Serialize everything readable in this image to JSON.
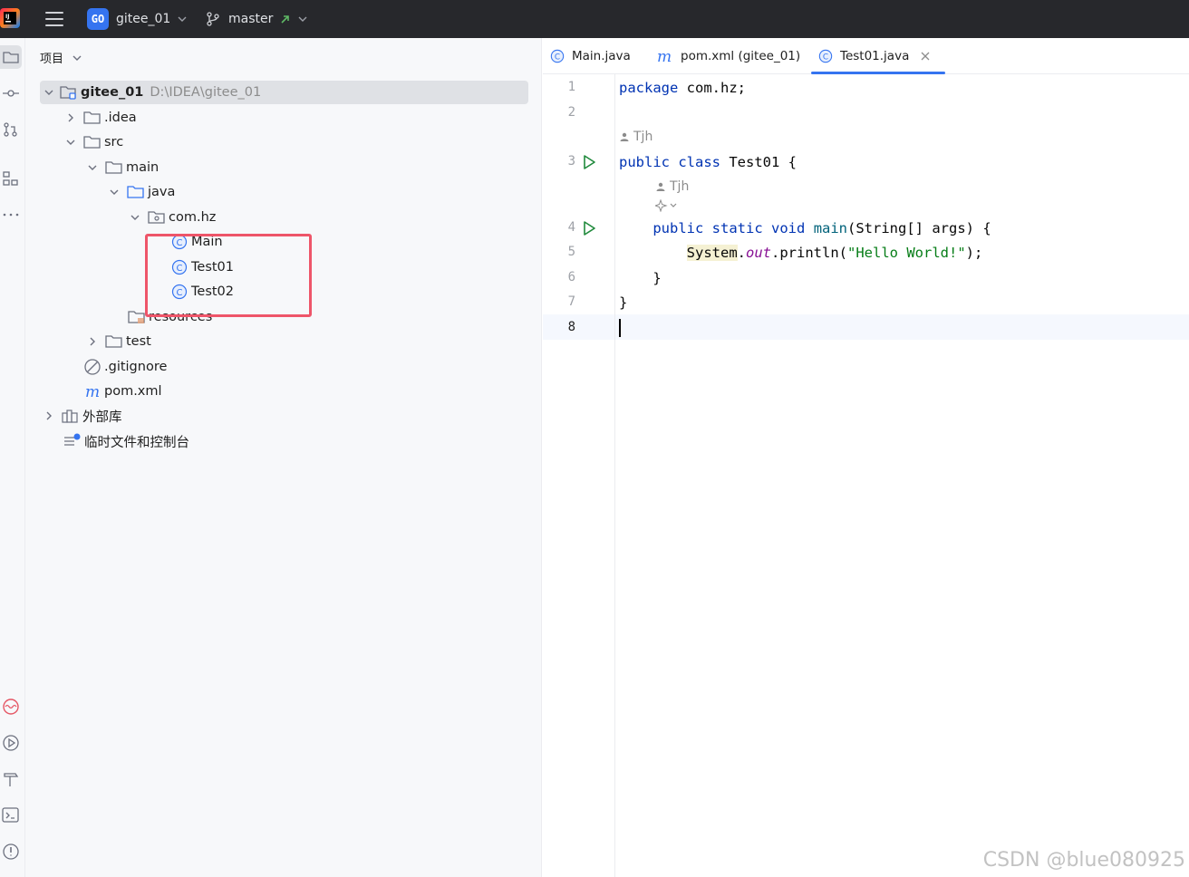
{
  "titlebar": {
    "project_badge": "GO",
    "project_name": "gitee_01",
    "branch_name": "master"
  },
  "project_panel": {
    "header": "项目",
    "tree": [
      {
        "label": "gitee_01",
        "path": "D:\\IDEA\\gitee_01",
        "icon": "module-folder-icon",
        "expanded": true
      },
      {
        "label": ".idea",
        "icon": "folder-icon",
        "expanded": false
      },
      {
        "label": "src",
        "icon": "folder-icon",
        "expanded": true
      },
      {
        "label": "main",
        "icon": "folder-icon",
        "expanded": true
      },
      {
        "label": "java",
        "icon": "source-folder-icon",
        "expanded": true
      },
      {
        "label": "com.hz",
        "icon": "package-icon",
        "expanded": true
      },
      {
        "label": "Main",
        "icon": "class-icon"
      },
      {
        "label": "Test01",
        "icon": "class-icon"
      },
      {
        "label": "Test02",
        "icon": "class-icon"
      },
      {
        "label": "resources",
        "icon": "resources-folder-icon"
      },
      {
        "label": "test",
        "icon": "folder-icon",
        "expanded": false
      },
      {
        "label": ".gitignore",
        "icon": "ignore-file-icon"
      },
      {
        "label": "pom.xml",
        "icon": "maven-icon"
      },
      {
        "label": "外部库",
        "icon": "library-icon",
        "expanded": false
      },
      {
        "label": "临时文件和控制台",
        "icon": "scratches-icon"
      }
    ]
  },
  "editor": {
    "tabs": [
      {
        "label": "Main.java",
        "icon": "class-icon",
        "active": false
      },
      {
        "label": "pom.xml (gitee_01)",
        "icon": "maven-icon",
        "active": false
      },
      {
        "label": "Test01.java",
        "icon": "class-icon",
        "active": true
      }
    ],
    "line_numbers": [
      "1",
      "2",
      "3",
      "4",
      "5",
      "6",
      "7",
      "8"
    ],
    "code": {
      "l1_kw": "package",
      "l1_rest": " com.hz;",
      "l3_kw1": "public",
      "l3_kw2": "class",
      "l3_rest": " Test01 {",
      "l4_kw1": "public",
      "l4_kw2": "static",
      "l4_kw3": "void",
      "l4_fn": "main",
      "l4_rest": "(String[] args) {",
      "l5_sys": "System",
      "l5_dot": ".",
      "l5_out": "out",
      "l5_call": ".println(",
      "l5_str": "\"Hello World!\"",
      "l5_end": ");",
      "l6": "    }",
      "l7": "}"
    },
    "author_hint_1": "Tjh",
    "author_hint_2": "Tjh"
  },
  "watermark": "CSDN @blue080925",
  "colors": {
    "accent": "#3574f0",
    "highlight_box": "#ee5569",
    "keyword": "#0033b3",
    "string": "#067d17",
    "run_green": "#208a3c"
  }
}
